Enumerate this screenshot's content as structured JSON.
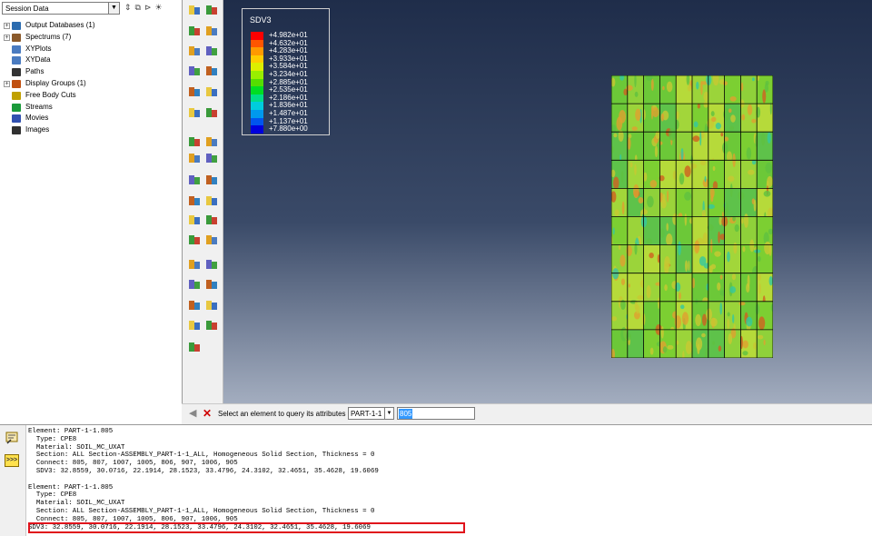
{
  "session": {
    "selected": "Session Data"
  },
  "tree": [
    {
      "label": "Output Databases (1)",
      "expander": "+",
      "icon": "database-icon",
      "color": "#2b6cb0"
    },
    {
      "label": "Spectrums (7)",
      "expander": "+",
      "icon": "spectrum-icon",
      "color": "#8b5a2b"
    },
    {
      "label": "XYPlots",
      "expander": "",
      "icon": "xyplot-icon",
      "color": "#4a7bc0"
    },
    {
      "label": "XYData",
      "expander": "",
      "icon": "xydata-icon",
      "color": "#4a7bc0"
    },
    {
      "label": "Paths",
      "expander": "",
      "icon": "path-icon",
      "color": "#333333"
    },
    {
      "label": "Display Groups (1)",
      "expander": "+",
      "icon": "display-group-icon",
      "color": "#c05010"
    },
    {
      "label": "Free Body Cuts",
      "expander": "",
      "icon": "free-body-cut-icon",
      "color": "#c0a000"
    },
    {
      "label": "Streams",
      "expander": "",
      "icon": "stream-icon",
      "color": "#1a9a3a"
    },
    {
      "label": "Movies",
      "expander": "",
      "icon": "movie-icon",
      "color": "#3050b0"
    },
    {
      "label": "Images",
      "expander": "",
      "icon": "image-icon",
      "color": "#303030"
    }
  ],
  "legend": {
    "title": "SDV3",
    "entries": [
      {
        "value": "+4.982e+01",
        "color": "#ff0000"
      },
      {
        "value": "+4.632e+01",
        "color": "#ff5500"
      },
      {
        "value": "+4.283e+01",
        "color": "#ff9900"
      },
      {
        "value": "+3.933e+01",
        "color": "#ffcc00"
      },
      {
        "value": "+3.584e+01",
        "color": "#ddee00"
      },
      {
        "value": "+3.234e+01",
        "color": "#99ee00"
      },
      {
        "value": "+2.885e+01",
        "color": "#55dd00"
      },
      {
        "value": "+2.535e+01",
        "color": "#00dd22"
      },
      {
        "value": "+2.186e+01",
        "color": "#00dd88"
      },
      {
        "value": "+1.836e+01",
        "color": "#00ccdd"
      },
      {
        "value": "+1.487e+01",
        "color": "#0099ee"
      },
      {
        "value": "+1.137e+01",
        "color": "#0055ee"
      },
      {
        "value": "+7.880e+00",
        "color": "#0000dd"
      }
    ]
  },
  "prompt": {
    "text": "Select an element to query its attributes",
    "part": "PART-1-1",
    "element": "805"
  },
  "messages": [
    "Element: PART-1-1.805",
    "  Type: CPE8",
    "  Material: SOIL_MC_UXAT",
    "  Section: ALL Section-ASSEMBLY_PART-1-1_ALL, Homogeneous Solid Section, Thickness = 0",
    "  Connect: 805, 807, 1007, 1005, 806, 907, 1006, 905",
    "  SDV3: 32.8559, 30.0716, 22.1914, 28.1523, 33.4796, 24.3102, 32.4651, 35.4628, 19.6069",
    "",
    "Element: PART-1-1.805",
    "  Type: CPE8",
    "  Material: SOIL_MC_UXAT",
    "  Section: ALL Section-ASSEMBLY_PART-1-1_ALL, Homogeneous Solid Section, Thickness = 0",
    "  Connect: 805, 807, 1007, 1005, 806, 907, 1006, 905",
    "SDV3: 32.8559, 30.0716, 22.1914, 28.1523, 33.4796, 24.3102, 32.4651, 35.4628, 19.6069"
  ],
  "colors": {
    "highlight": "#e0121b",
    "mesh_base": "#8fd13a",
    "viewport_top": "#1f2d4a"
  }
}
